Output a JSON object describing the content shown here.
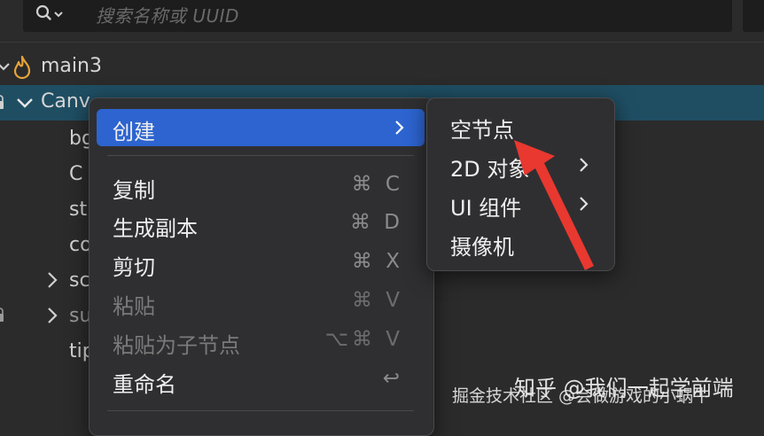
{
  "search": {
    "placeholder": "搜索名称或 UUID",
    "icon": "search-dropdown-icon"
  },
  "tree": {
    "scene": {
      "label": "main3",
      "icon": "scene-flame-icon"
    },
    "canvas": {
      "label": "Canv"
    },
    "children": [
      {
        "label": "bg"
      },
      {
        "label": "C"
      },
      {
        "label": "st"
      },
      {
        "label": "co"
      },
      {
        "label": "sc"
      },
      {
        "label": "su"
      },
      {
        "label": "tip"
      }
    ]
  },
  "context_menu": {
    "items": [
      {
        "label": "创建",
        "shortcut": "",
        "has_submenu": true,
        "active": true,
        "disabled": false
      },
      {
        "label": "复制",
        "shortcut": "⌘ C",
        "has_submenu": false,
        "active": false,
        "disabled": false
      },
      {
        "label": "生成副本",
        "shortcut": "⌘ D",
        "has_submenu": false,
        "active": false,
        "disabled": false
      },
      {
        "label": "剪切",
        "shortcut": "⌘ X",
        "has_submenu": false,
        "active": false,
        "disabled": false
      },
      {
        "label": "粘贴",
        "shortcut": "⌘ V",
        "has_submenu": false,
        "active": false,
        "disabled": true
      },
      {
        "label": "粘贴为子节点",
        "shortcut": "⌥⌘ V",
        "has_submenu": false,
        "active": false,
        "disabled": true
      },
      {
        "label": "重命名",
        "shortcut": "↩",
        "has_submenu": false,
        "active": false,
        "disabled": false
      }
    ]
  },
  "create_submenu": {
    "items": [
      {
        "label": "空节点",
        "has_submenu": false
      },
      {
        "label": "2D 对象",
        "has_submenu": true
      },
      {
        "label": "UI 组件",
        "has_submenu": true
      },
      {
        "label": "摄像机",
        "has_submenu": false
      }
    ]
  },
  "watermark": {
    "zhihu": "知乎 @我们一起学前端",
    "juejin": "掘金技术社区 @会做游戏的小蜗牛"
  },
  "colors": {
    "background": "#2b2b2b",
    "menu_highlight": "#2d64d0",
    "tree_selection": "#1f4e63",
    "annotation_arrow": "#e8382f"
  }
}
